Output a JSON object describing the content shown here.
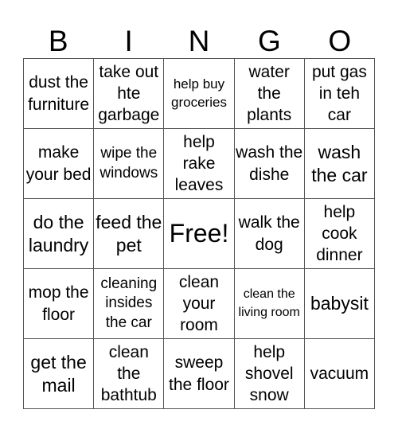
{
  "header": {
    "letters": [
      "B",
      "I",
      "N",
      "G",
      "O"
    ]
  },
  "board": {
    "rows": [
      [
        "dust the furniture",
        "take out hte garbage",
        "help buy groceries",
        "water the plants",
        "put gas in teh car"
      ],
      [
        "make your bed",
        "wipe the windows",
        "help rake leaves",
        "wash the dishe",
        "wash the car"
      ],
      [
        "do the laundry",
        "feed the pet",
        "Free!",
        "walk the dog",
        "help cook dinner"
      ],
      [
        "mop the floor",
        "cleaning insides the car",
        "clean your room",
        "clean the living room",
        "babysit"
      ],
      [
        "get the mail",
        "clean the bathtub",
        "sweep the floor",
        "help shovel snow",
        "vacuum"
      ]
    ]
  }
}
